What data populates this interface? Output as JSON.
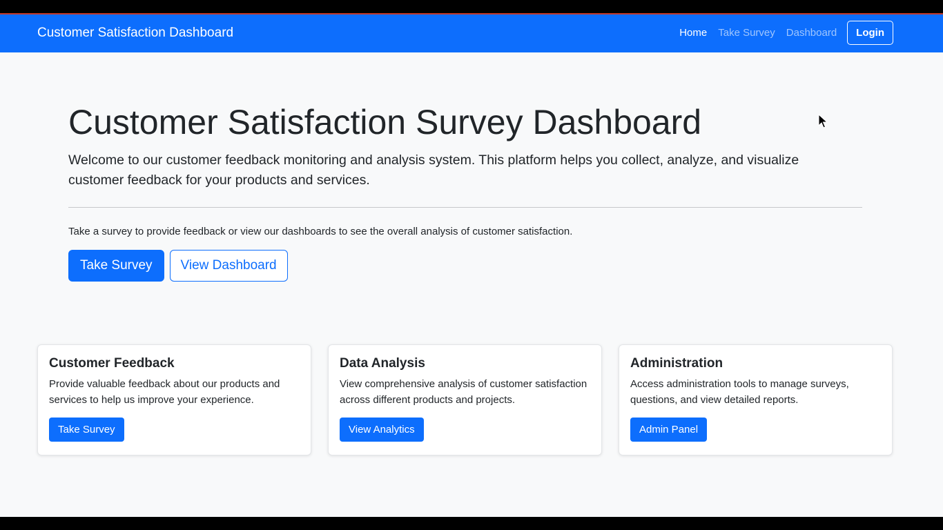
{
  "navbar": {
    "brand": "Customer Satisfaction Dashboard",
    "links": [
      {
        "label": "Home",
        "active": true
      },
      {
        "label": "Take Survey",
        "active": false
      },
      {
        "label": "Dashboard",
        "active": false
      }
    ],
    "login_label": "Login"
  },
  "hero": {
    "title": "Customer Satisfaction Survey Dashboard",
    "lead": "Welcome to our customer feedback monitoring and analysis system. This platform helps you collect, analyze, and visualize customer feedback for your products and services.",
    "subtext": "Take a survey to provide feedback or view our dashboards to see the overall analysis of customer satisfaction.",
    "primary_button": "Take Survey",
    "secondary_button": "View Dashboard"
  },
  "cards": [
    {
      "title": "Customer Feedback",
      "text": "Provide valuable feedback about our products and services to help us improve your experience.",
      "button": "Take Survey"
    },
    {
      "title": "Data Analysis",
      "text": "View comprehensive analysis of customer satisfaction across different products and projects.",
      "button": "View Analytics"
    },
    {
      "title": "Administration",
      "text": "Access administration tools to manage surveys, questions, and view detailed reports.",
      "button": "Admin Panel"
    }
  ],
  "colors": {
    "primary": "#0d6efd",
    "background": "#f8f9fa",
    "text": "#212529"
  }
}
